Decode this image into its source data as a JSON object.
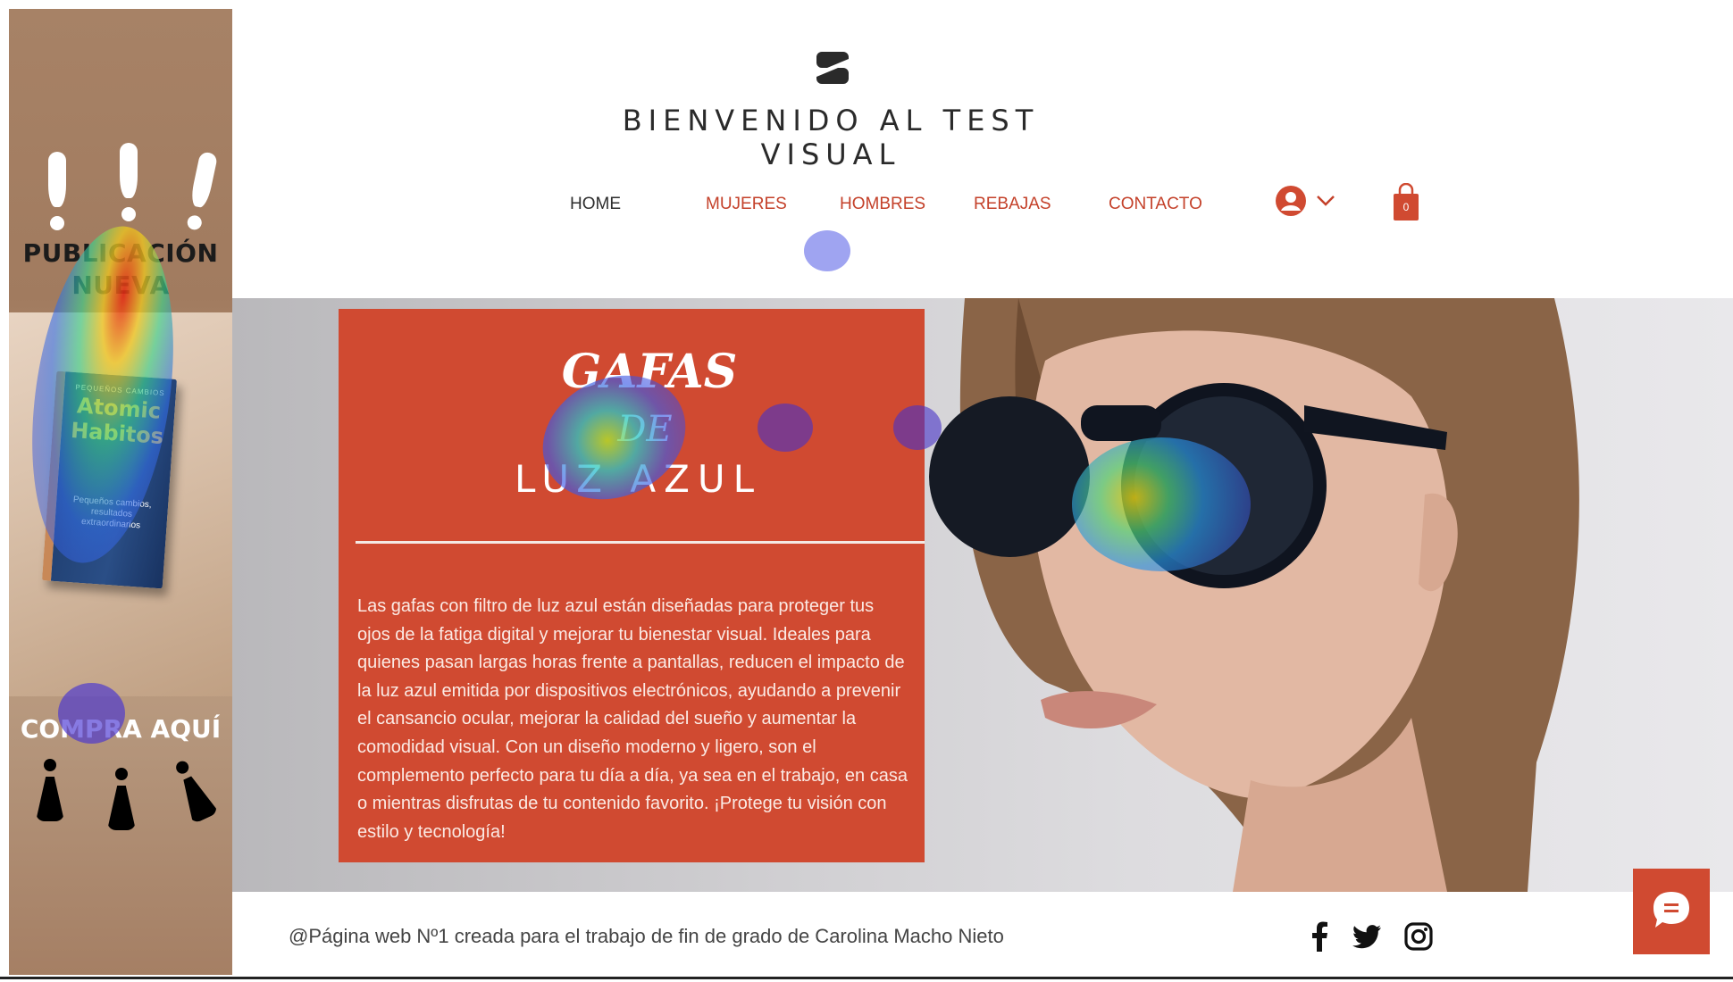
{
  "banner": {
    "headline_line1": "PUBLICACIÓN",
    "headline_line2": "NUEVA",
    "cta": "COMPRA AQUÍ",
    "book": {
      "top_text": "PEQUEÑOS CAMBIOS",
      "title_line1": "Atomic",
      "title_line2": "Habitos",
      "subtitle": "Pequeños cambios, resultados extraordinarios"
    }
  },
  "header": {
    "site_title": "BIENVENIDO AL TEST VISUAL",
    "logo_icon": "s-logo-icon"
  },
  "nav": {
    "items": [
      {
        "label": "HOME",
        "active": true
      },
      {
        "label": "MUJERES",
        "active": false
      },
      {
        "label": "HOMBRES",
        "active": false
      },
      {
        "label": "REBAJAS",
        "active": false
      },
      {
        "label": "CONTACTO",
        "active": false
      }
    ],
    "account_icon": "user-icon",
    "dropdown_icon": "chevron-down-icon",
    "cart_icon": "shopping-bag-icon",
    "cart_count": "0"
  },
  "hero": {
    "title_line1": "GAFAS",
    "title_line2": "DE",
    "title_line3": "LUZ AZUL",
    "body": "Las gafas con filtro de luz azul están diseñadas para proteger tus ojos de la fatiga digital y mejorar tu bienestar visual. Ideales para quienes pasan largas horas frente a pantallas, reducen el impacto de la luz azul emitida por dispositivos electrónicos, ayudando a prevenir el cansancio ocular, mejorar la calidad del sueño y aumentar la comodidad visual. Con un diseño moderno y ligero, son el complemento perfecto para tu día a día, ya sea en el trabajo, en casa o mientras disfrutas de tu contenido favorito. ¡Protege tu visión con estilo y tecnología!"
  },
  "footer": {
    "credit": "@Página web Nº1 creada para el trabajo de fin de grado de Carolina Macho Nieto",
    "social": [
      "facebook-icon",
      "twitter-icon",
      "instagram-icon"
    ],
    "chat_icon": "chat-icon"
  },
  "colors": {
    "accent": "#d04a31",
    "nav_text": "#c4412a",
    "banner_bg": "#a78266",
    "hero_bg": "#cfced1"
  }
}
